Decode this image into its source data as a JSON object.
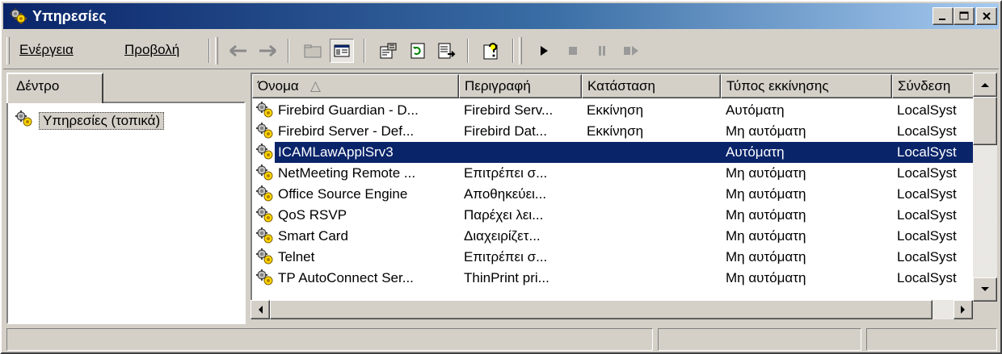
{
  "window": {
    "title": "Υπηρεσίες"
  },
  "menu": {
    "action": "Ενέργεια",
    "view": "Προβολή"
  },
  "icons": {
    "window": "services-gears-icon",
    "back": "back-arrow-icon",
    "forward": "forward-arrow-icon",
    "up": "up-folder-icon",
    "show_tree": "show-hide-tree-icon",
    "properties": "properties-icon",
    "refresh": "refresh-icon",
    "export": "export-list-icon",
    "help": "help-icon",
    "start": "start-service-icon",
    "stop": "stop-service-icon",
    "pause": "pause-service-icon",
    "restart": "restart-service-icon"
  },
  "tree": {
    "tab_label": "Δέντρο",
    "root_label": "Υπηρεσίες (τοπικά)"
  },
  "list": {
    "columns": [
      "Όνομα",
      "Περιγραφή",
      "Κατάσταση",
      "Τύπος εκκίνησης",
      "Σύνδεση"
    ],
    "sort_indicator": "△",
    "rows": [
      {
        "name": "Firebird Guardian - D...",
        "description": "Firebird Serv...",
        "status": "Εκκίνηση",
        "startup": "Αυτόματη",
        "logon": "LocalSyst"
      },
      {
        "name": "Firebird Server - Def...",
        "description": "Firebird Dat...",
        "status": "Εκκίνηση",
        "startup": "Μη αυτόματη",
        "logon": "LocalSyst"
      },
      {
        "name": "ICAMLawApplSrv3",
        "description": "",
        "status": "",
        "startup": "Αυτόματη",
        "logon": "LocalSyst",
        "selected": true
      },
      {
        "name": "NetMeeting Remote ...",
        "description": "Επιτρέπει σ...",
        "status": "",
        "startup": "Μη αυτόματη",
        "logon": "LocalSyst"
      },
      {
        "name": "Office Source Engine",
        "description": "Αποθηκεύει...",
        "status": "",
        "startup": "Μη αυτόματη",
        "logon": "LocalSyst"
      },
      {
        "name": "QoS RSVP",
        "description": "Παρέχει λει...",
        "status": "",
        "startup": "Μη αυτόματη",
        "logon": "LocalSyst"
      },
      {
        "name": "Smart Card",
        "description": "Διαχειρίζετ...",
        "status": "",
        "startup": "Μη αυτόματη",
        "logon": "LocalSyst"
      },
      {
        "name": "Telnet",
        "description": "Επιτρέπει σ...",
        "status": "",
        "startup": "Μη αυτόματη",
        "logon": "LocalSyst"
      },
      {
        "name": "TP AutoConnect Ser...",
        "description": "ThinPrint pri...",
        "status": "",
        "startup": "Μη αυτόματη",
        "logon": "LocalSyst"
      }
    ]
  },
  "colors": {
    "title_gradient_start": "#0a246a",
    "title_gradient_end": "#a6caf0",
    "selection": "#0a246a",
    "face": "#d4d0c8"
  }
}
